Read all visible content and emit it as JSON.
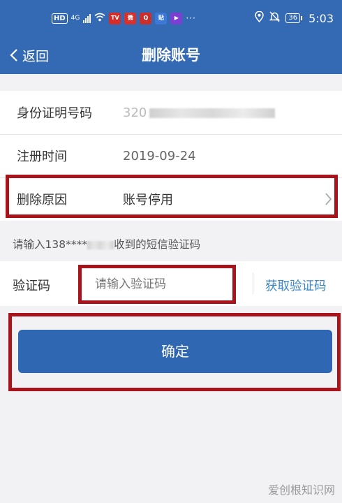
{
  "status_bar": {
    "hd": "HD",
    "network": "4G",
    "battery": "36",
    "time": "5:03",
    "apps": [
      {
        "icon": "tv-app-icon",
        "text": "TV",
        "color": "#d22d2a"
      },
      {
        "icon": "weibo-icon",
        "text": "微",
        "color": "#d8312b"
      },
      {
        "icon": "search-app-icon",
        "text": "Q",
        "color": "#c9302c"
      },
      {
        "icon": "news-app-icon",
        "text": "贴",
        "color": "#3b78d8"
      },
      {
        "icon": "video-app-icon",
        "text": "▶",
        "color": "#7b3fd1"
      }
    ]
  },
  "nav": {
    "back_label": "返回",
    "title": "删除账号"
  },
  "form": {
    "id_label": "身份证明号码",
    "id_value_prefix": "320",
    "register_label": "注册时间",
    "register_value": "2019-09-24",
    "reason_label": "删除原因",
    "reason_value": "账号停用"
  },
  "sms": {
    "hint_prefix": "请输入138****",
    "hint_suffix": "收到的短信验证码",
    "code_label": "验证码",
    "code_placeholder": "请输入验证码",
    "get_code": "获取验证码"
  },
  "confirm_label": "确定",
  "watermark": "爱创根知识网"
}
